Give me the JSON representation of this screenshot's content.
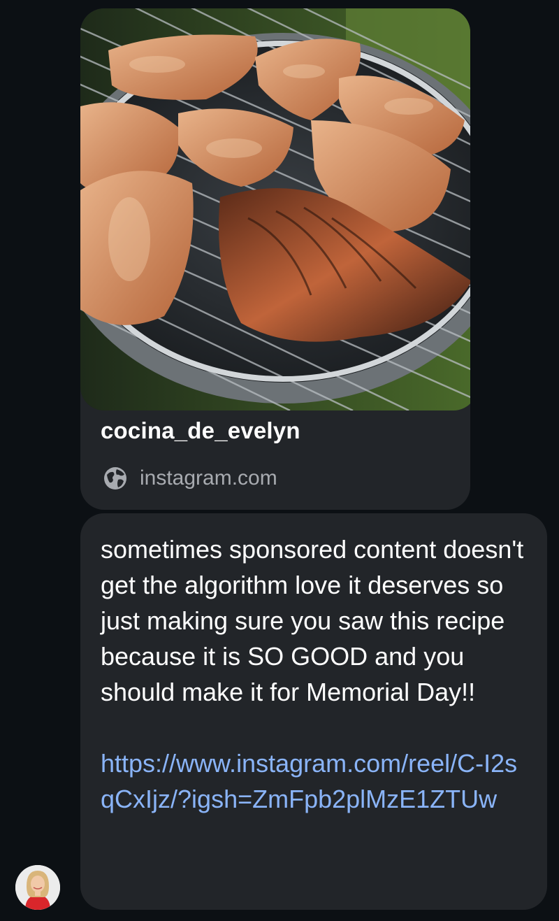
{
  "preview": {
    "title": "cocina_de_evelyn",
    "domain": "instagram.com",
    "image_icon": "grilled-chicken-photo",
    "domain_icon": "globe-icon"
  },
  "message": {
    "text": "sometimes sponsored content doesn't get the algorithm love it deserves so just making sure you saw this recipe because it is SO GOOD and you should make it for Memorial Day!!",
    "link": "https://www.instagram.com/reel/C-I2sqCxIjz/?igsh=ZmFpb2plMzE1ZTUw"
  },
  "sender": {
    "avatar_icon": "avatar"
  },
  "colors": {
    "background": "#0c1014",
    "bubble": "#222529",
    "link": "#8ab4f8",
    "secondary_text": "#a8abb0"
  }
}
